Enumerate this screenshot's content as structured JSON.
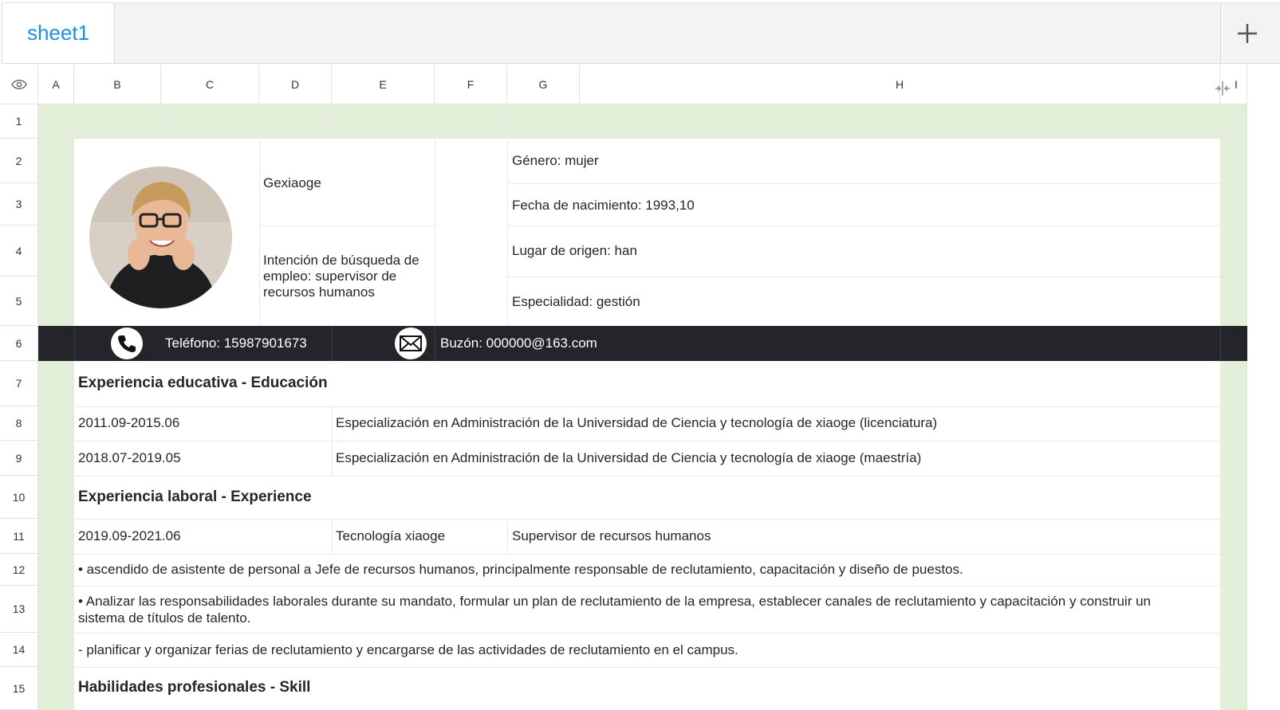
{
  "tabs": {
    "active": "sheet1"
  },
  "columns": [
    "A",
    "B",
    "C",
    "D",
    "E",
    "F",
    "G",
    "H",
    "I"
  ],
  "rows": [
    "1",
    "2",
    "3",
    "4",
    "5",
    "6",
    "7",
    "8",
    "9",
    "10",
    "11",
    "12",
    "13",
    "14",
    "15"
  ],
  "profile": {
    "name": "Gexiaoge",
    "intent": "Intención de búsqueda de empleo: supervisor de recursos humanos",
    "gender": "Género: mujer",
    "birth": "Fecha de nacimiento: 1993,10",
    "origin": "Lugar de origen: han",
    "specialty": "Especialidad: gestión"
  },
  "contact": {
    "phone": "Teléfono: 15987901673",
    "mail": "Buzón: 000000@163.com",
    "phone_icon": "phone-icon",
    "mail_icon": "envelope-icon"
  },
  "education": {
    "heading": "Experiencia educativa - Educación",
    "items": [
      {
        "period": "2011.09-2015.06",
        "detail": "Especialización en Administración de la Universidad de Ciencia y tecnología de xiaoge (licenciatura)"
      },
      {
        "period": "2018.07-2019.05",
        "detail": "Especialización en Administración de la Universidad de Ciencia y tecnología de xiaoge (maestría)"
      }
    ]
  },
  "work": {
    "heading": "Experiencia laboral - Experience",
    "period": "2019.09-2021.06",
    "company": "Tecnología xiaoge",
    "role": "Supervisor de recursos humanos",
    "bullet1": "• ascendido de asistente de personal a Jefe de recursos humanos, principalmente responsable de reclutamiento, capacitación y diseño de puestos.",
    "bullet2_line1": "• Analizar las responsabilidades laborales durante su mandato, formular un plan de reclutamiento de la empresa, establecer canales de reclutamiento y capacitación y construir un",
    "bullet2_line2": "sistema de títulos de talento.",
    "bullet3": "- planificar y organizar ferias de reclutamiento y encargarse de las actividades de reclutamiento en el campus."
  },
  "skills": {
    "heading": "Habilidades profesionales - Skill"
  },
  "colors": {
    "accent": "#1a8fe3",
    "margin_green": "#e2eed8",
    "contact_bar": "#23252a"
  }
}
